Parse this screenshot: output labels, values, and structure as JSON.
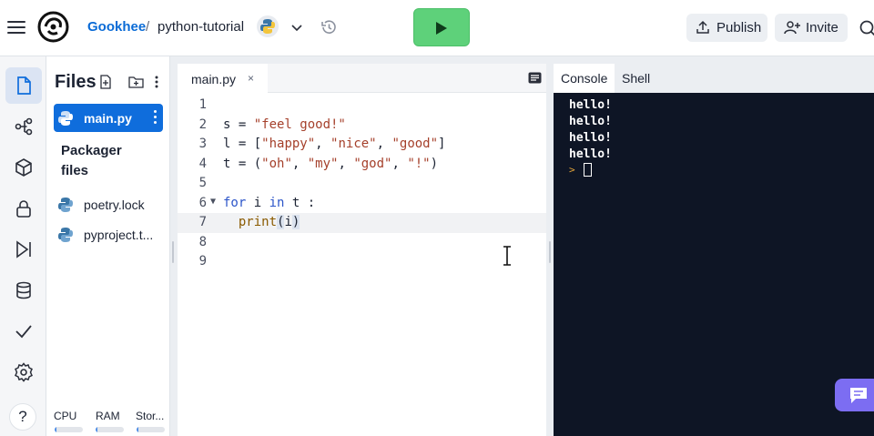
{
  "header": {
    "user": "Gookhee",
    "separator": "/",
    "repl_name": "python-tutorial",
    "publish_label": "Publish",
    "invite_label": "Invite"
  },
  "files": {
    "title": "Files",
    "items": [
      {
        "label": "main.py",
        "icon": "python-icon",
        "active": true
      },
      {
        "label": "poetry.lock",
        "icon": "python-icon",
        "active": false
      },
      {
        "label": "pyproject.t...",
        "icon": "python-icon",
        "active": false
      }
    ],
    "folder_label": "Packager files",
    "resources": [
      {
        "label": "CPU",
        "usage": 0.08
      },
      {
        "label": "RAM",
        "usage": 0.08
      },
      {
        "label": "Stor...",
        "usage": 0.08
      }
    ]
  },
  "editor": {
    "tab_label": "main.py",
    "tab_close": "×",
    "line_numbers": [
      "1",
      "2",
      "3",
      "4",
      "5",
      "6",
      "7",
      "8",
      "9"
    ]
  },
  "console": {
    "tabs": [
      "Console",
      "Shell"
    ],
    "output": [
      "hello!",
      "hello!",
      "hello!",
      "hello!"
    ],
    "prompt": ">"
  },
  "help_label": "?",
  "colors": {
    "run": "#5ed17a",
    "accent": "#0f6ddc",
    "console_bg": "#0e1525",
    "chat": "#7c6df2"
  }
}
